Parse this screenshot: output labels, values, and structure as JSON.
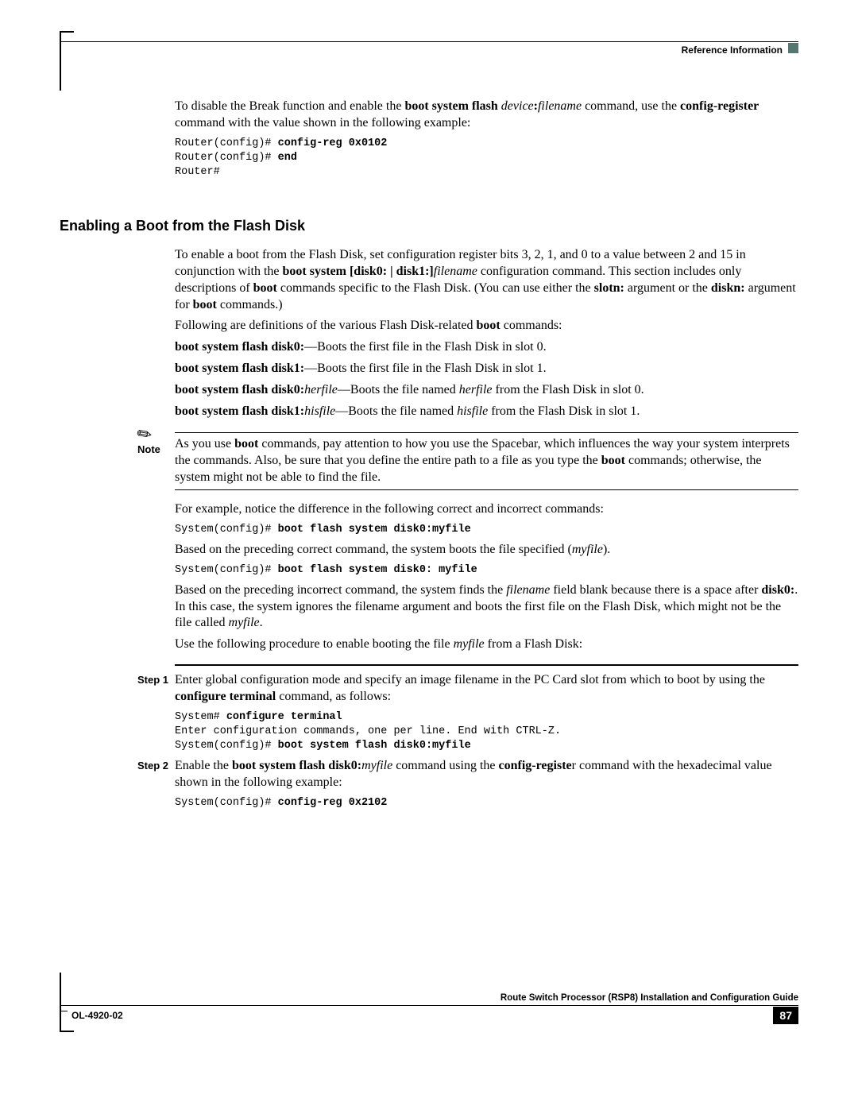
{
  "header": {
    "section": "Reference Information"
  },
  "intro": {
    "p1_a": "To disable the Break function and enable the ",
    "p1_b": "boot system flash ",
    "p1_c": "device",
    "p1_d": ":",
    "p1_e": "filename",
    "p1_f": " command, use the ",
    "p1_g": "config-register",
    "p1_h": " command with the value shown in the following example:",
    "code1_a": "Router(config)# ",
    "code1_b": "config-reg 0x0102",
    "code2_a": "Router(config)# ",
    "code2_b": "end",
    "code3": "Router#"
  },
  "section": {
    "heading": "Enabling a Boot from the Flash Disk",
    "p1_a": "To enable a boot from the Flash Disk, set configuration register bits 3, 2, 1, and 0 to a value between 2 and 15 in conjunction with the ",
    "p1_b": "boot system [disk0: | disk1:]",
    "p1_c": "filename",
    "p1_d": " configuration command. This section includes only descriptions of ",
    "p1_e": "boot",
    "p1_f": " commands specific to the Flash Disk. (You can use either the ",
    "p1_g": "slotn:",
    "p1_h": " argument or the ",
    "p1_i": "diskn:",
    "p1_j": " argument for ",
    "p1_k": "boot",
    "p1_l": " commands.)",
    "p2_a": "Following are definitions of the various Flash Disk-related ",
    "p2_b": "boot",
    "p2_c": " commands:",
    "def1_a": "boot system flash disk0:",
    "def1_b": "—Boots the first file in the Flash Disk in slot 0.",
    "def2_a": "boot system flash disk1:",
    "def2_b": "—Boots the first file in the Flash Disk in slot 1.",
    "def3_a": "boot system flash disk0:",
    "def3_b": "herfile",
    "def3_c": "—Boots the file named ",
    "def3_d": "herfile",
    "def3_e": " from the Flash Disk in slot 0.",
    "def4_a": "boot system flash disk1:",
    "def4_b": "hisfile",
    "def4_c": "—Boots the file named ",
    "def4_d": "hisfile",
    "def4_e": " from the Flash Disk in slot 1."
  },
  "note": {
    "label": "Note",
    "t1": "As you use ",
    "t2": "boot",
    "t3": " commands, pay attention to how you use the Spacebar, which influences the way your system interprets the commands. Also, be sure that you define the entire path to a file as you type the ",
    "t4": "boot",
    "t5": " commands; otherwise, the system might not be able to find the file."
  },
  "example": {
    "p1": "For example, notice the difference in the following correct and incorrect commands:",
    "c1_a": "System(config)# ",
    "c1_b": "boot flash system disk0:myfile",
    "p2_a": "Based on the preceding correct command, the system boots the file specified (",
    "p2_b": "myfile",
    "p2_c": ").",
    "c2_a": "System(config)# ",
    "c2_b": "boot flash system disk0: myfile",
    "p3_a": "Based on the preceding incorrect command, the system finds the ",
    "p3_b": "filename",
    "p3_c": " field blank because there is a space after ",
    "p3_d": "disk0:",
    "p3_e": ". In this case, the system ignores the filename argument and boots the first file on the Flash Disk, which might not be the file called ",
    "p3_f": "myfile",
    "p3_g": ".",
    "p4_a": "Use the following procedure to enable booting the file ",
    "p4_b": "myfile",
    "p4_c": " from a Flash Disk:"
  },
  "steps": {
    "s1_label": "Step 1",
    "s1_a": "Enter global configuration mode and specify an image filename in the PC Card slot from which to boot by using the ",
    "s1_b": "configure terminal",
    "s1_c": " command, as follows:",
    "s1c1_a": "System# ",
    "s1c1_b": "configure terminal",
    "s1c2": "Enter configuration commands, one per line. End with CTRL-Z.",
    "s1c3_a": "System(config)# ",
    "s1c3_b": "boot system flash disk0:myfile",
    "s2_label": "Step 2",
    "s2_a": "Enable the ",
    "s2_b": "boot system flash disk0:",
    "s2_c": "myfile",
    "s2_d": " command using the ",
    "s2_e": "config-registe",
    "s2_f": "r command with the hexadecimal value shown in the following example:",
    "s2c1_a": "System(config)# ",
    "s2c1_b": "config-reg 0x2102"
  },
  "footer": {
    "title": "Route Switch Processor (RSP8) Installation and Configuration Guide",
    "docnum": "OL-4920-02",
    "page": "87"
  }
}
